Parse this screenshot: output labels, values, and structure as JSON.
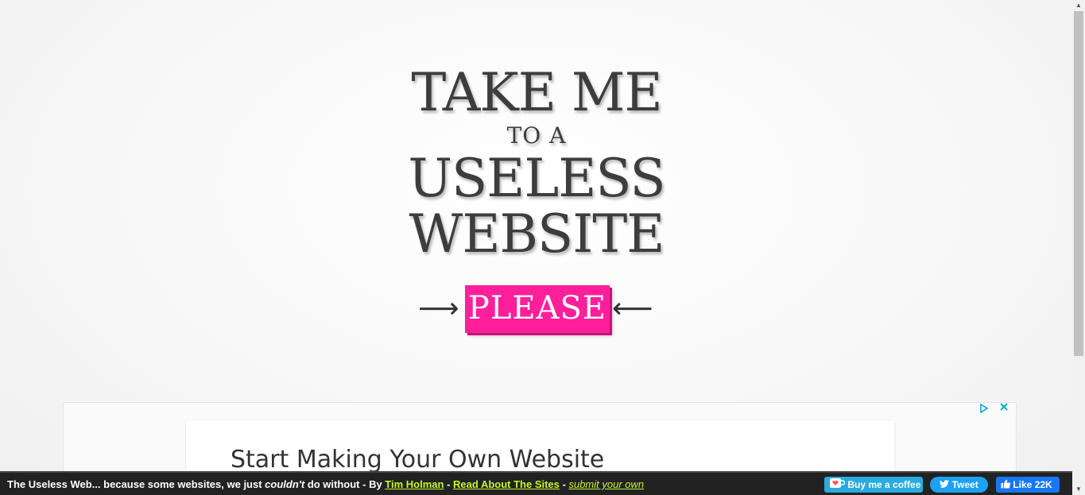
{
  "hero": {
    "line1": "TAKE ME",
    "line2": "TO A",
    "line3": "USELESS",
    "line4": "WEBSITE"
  },
  "please": {
    "label": "PLEASE",
    "left_arrow": "⟶",
    "right_arrow": "⟵",
    "color": "#ff1f9b"
  },
  "ad": {
    "headline": "Start Making Your Own Website",
    "choices_icon": "ad-choices-icon",
    "close_icon": "close-icon"
  },
  "footer": {
    "prefix": "The Useless Web... because some websites, we just ",
    "emph": "couldn't",
    "middle": " do without - By ",
    "author": "Tim Holman",
    "sep1": " - ",
    "read_link": "Read About The Sites",
    "sep2": " - ",
    "submit_link": "submit your own",
    "link_color": "#c3f62b"
  },
  "social": {
    "coffee": "Buy me a coffee",
    "tweet": "Tweet",
    "like": "Like 22K"
  }
}
